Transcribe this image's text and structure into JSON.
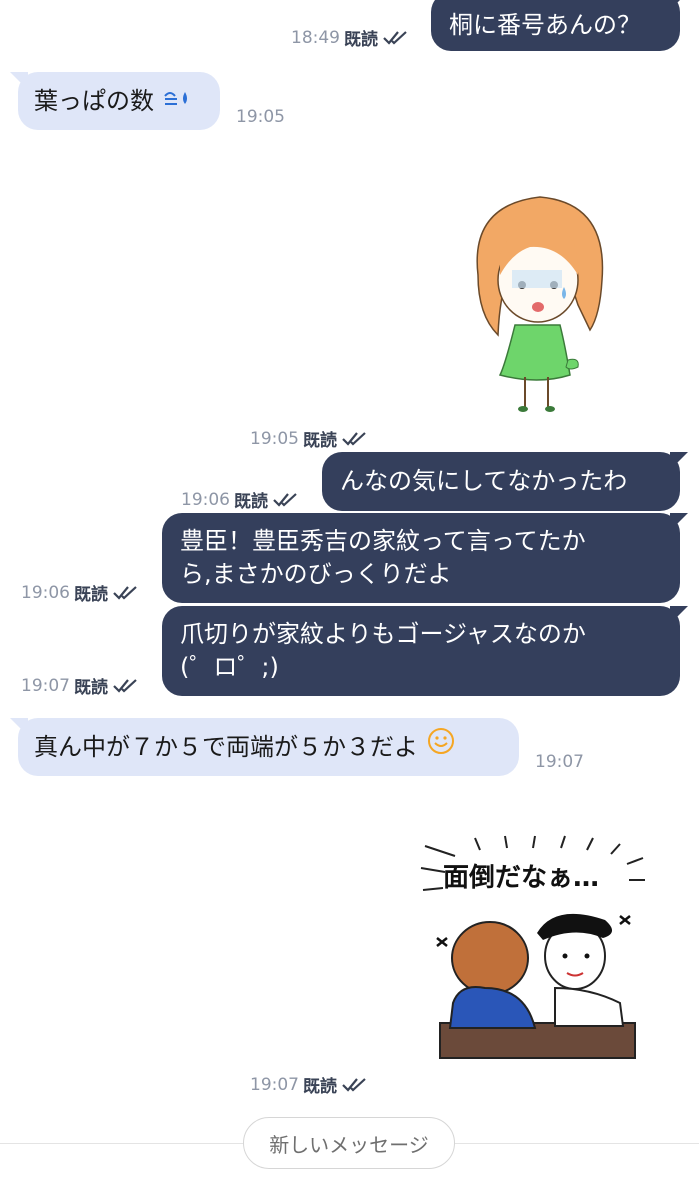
{
  "read_label": "既読",
  "messages": [
    {
      "text": "桐に番号あんの？",
      "time": "18:49"
    },
    {
      "text": "葉っぱの数",
      "time": "19:05"
    },
    {
      "time": "19:05"
    },
    {
      "text": "んなの気にしてなかったわ",
      "time": "19:06"
    },
    {
      "line1": "豊臣！豊臣秀吉の家紋って言ってたか",
      "line2": "ら,まさかのびっくりだよ",
      "time": "19:06"
    },
    {
      "line1": "爪切りが家紋よりもゴージャスなのか",
      "line2": "(゜ロ゜;)",
      "time": "19:07"
    },
    {
      "text": "真ん中が７か５で両端が５か３だよ",
      "time": "19:07"
    },
    {
      "time": "19:07",
      "sticker_text": "面倒だなぁ…"
    }
  ],
  "new_messages_label": "新しいメッセージ",
  "colors": {
    "outgoing": "#343f5c",
    "incoming": "#dfe6f8",
    "emoji": "#f5a623",
    "sweat": "#2b6fd6"
  }
}
